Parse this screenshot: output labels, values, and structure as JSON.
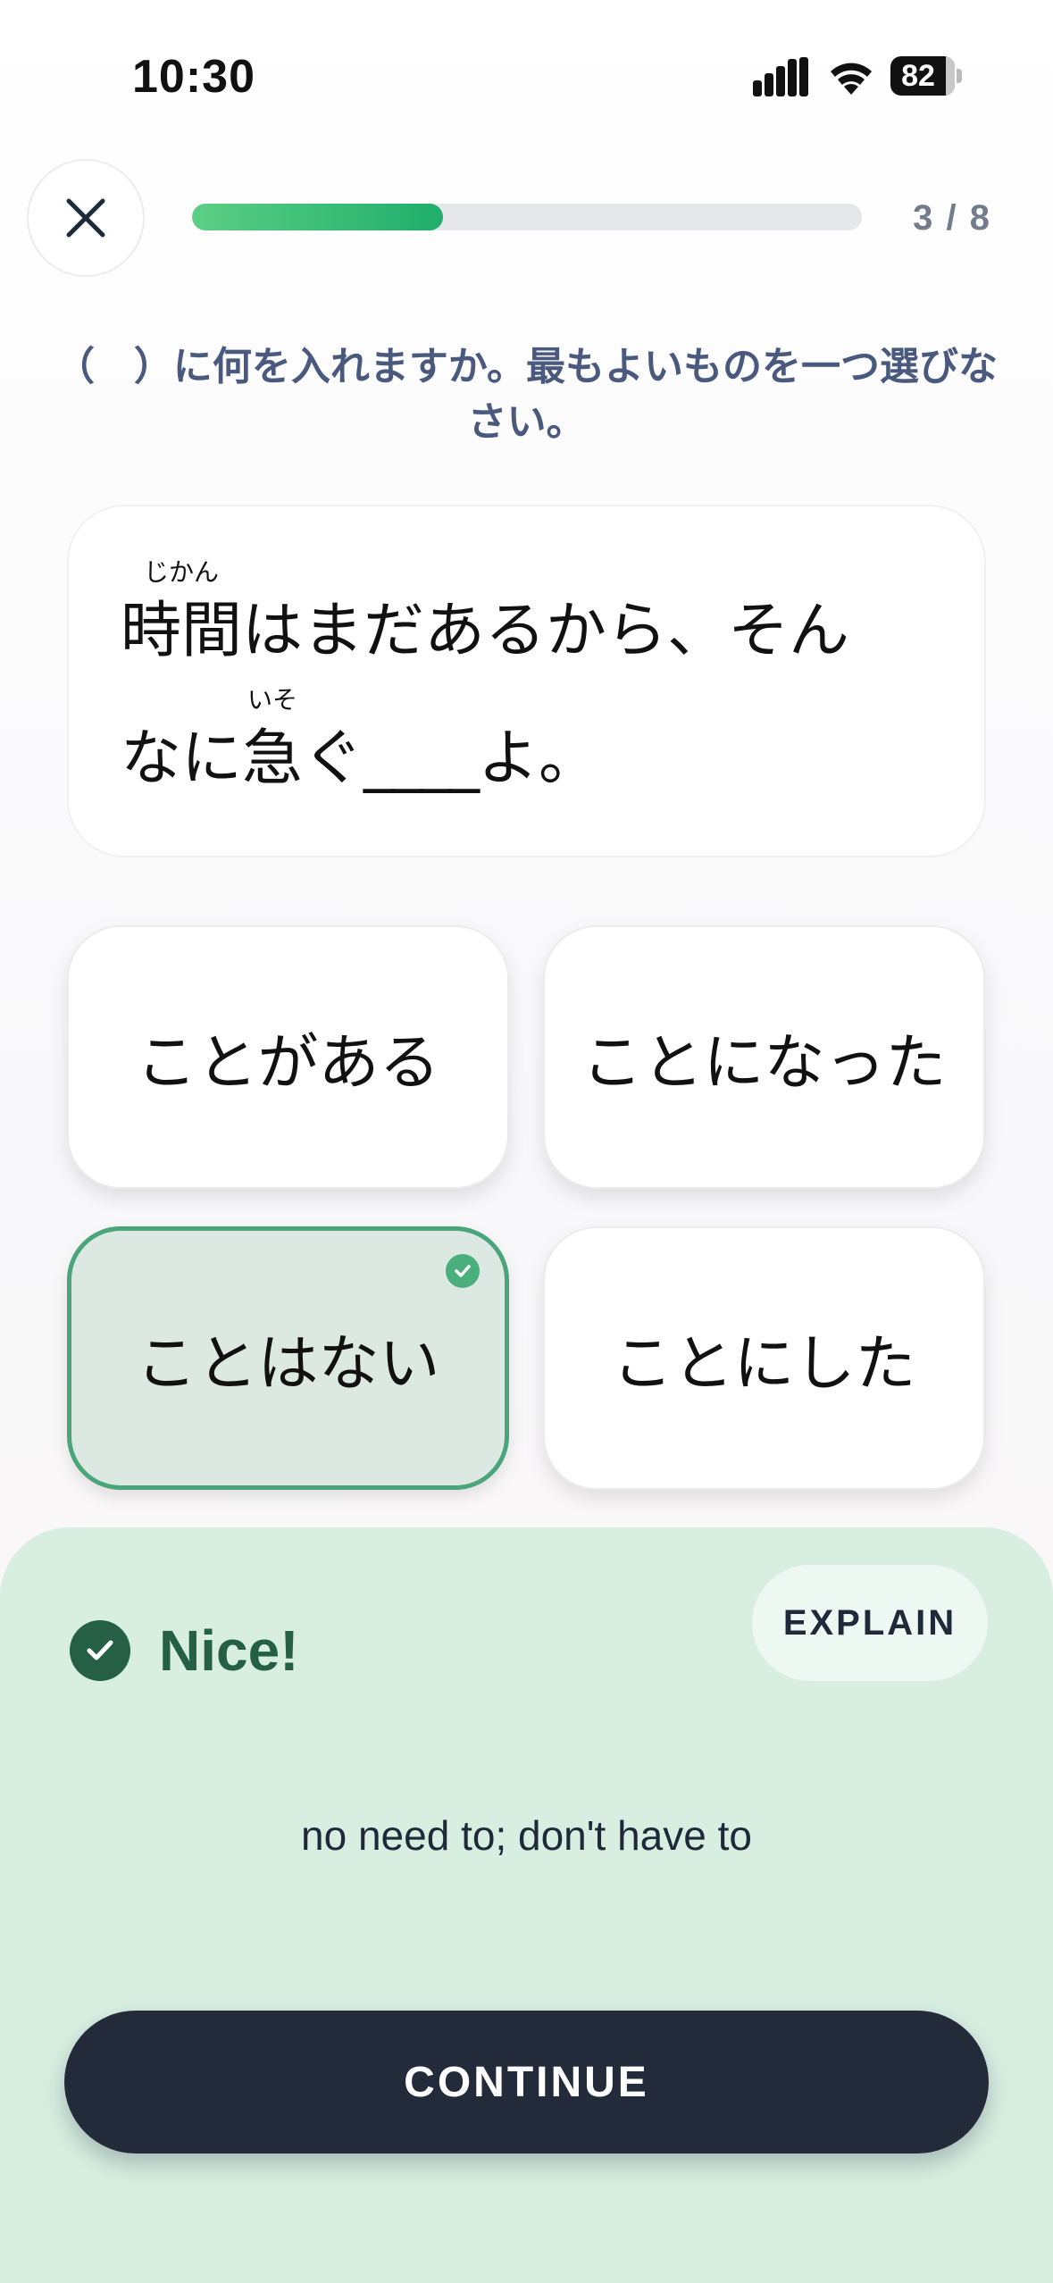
{
  "status_bar": {
    "time": "10:30",
    "battery": "82",
    "icons": [
      "signal-icon",
      "wifi-icon",
      "battery-icon"
    ]
  },
  "top_bar": {
    "close_icon": "close-icon",
    "progress": {
      "current": 3,
      "total": 8,
      "fraction": 0.375,
      "label": "3 / 8"
    }
  },
  "question": {
    "instruction": "（　）に何を入れますか。最もよいものを一つ選びなさい。",
    "line1": {
      "word": "時間",
      "word_reading": "じかん",
      "rest": "はまだあるから、そん"
    },
    "line2": {
      "prefix": "なに",
      "word": "急",
      "word_reading": "いそ",
      "after_word": "ぐ",
      "blank": "____",
      "suffix": "よ。"
    }
  },
  "options": [
    {
      "label": "ことがある",
      "selected": false
    },
    {
      "label": "ことになった",
      "selected": false
    },
    {
      "label": "ことはない",
      "selected": true
    },
    {
      "label": "ことにした",
      "selected": false
    }
  ],
  "feedback": {
    "title": "Nice!",
    "explain_label": "EXPLAIN",
    "meaning": "no need to; don't have to",
    "continue_label": "CONTINUE"
  },
  "colors": {
    "accent_green": "#4aa57a",
    "feedback_bg": "#d7eee1",
    "feedback_dark": "#256044",
    "button_dark": "#232b3b",
    "instruction_text": "#4a5a7e"
  }
}
